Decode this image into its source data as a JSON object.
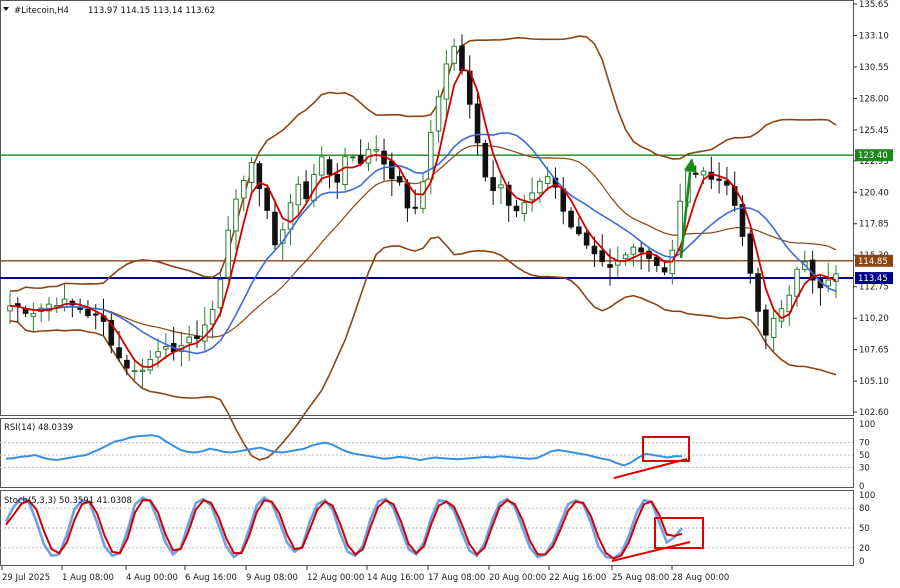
{
  "header": {
    "symbol": "#Litecoin,H4",
    "ohlc": "113.97 114.15 113.14 113.62"
  },
  "colors": {
    "up": "#2e7d32",
    "down": "#111111",
    "sma_fast": "#d00000",
    "sma_slow": "#3d6bd9",
    "bollinger": "#8b4513",
    "rsi": "#3a8fe0",
    "stoch_main": "#6fa0e8",
    "stoch_signal": "#d00000",
    "green_level": "#1a8a1a",
    "brown_level": "#8b4513",
    "blue_level": "#00008b",
    "annotation": "#e00000"
  },
  "chart_data": [
    {
      "type": "candlestick",
      "title": "#Litecoin,H4",
      "ylim": [
        102.6,
        135.65
      ],
      "y_ticks": [
        "135.65",
        "133.10",
        "130.55",
        "128.00",
        "125.45",
        "122.95",
        "120.40",
        "117.85",
        "115.30",
        "112.75",
        "110.20",
        "107.65",
        "105.10",
        "102.60"
      ],
      "x_ticks": [
        "29 Jul 2025",
        "1 Aug 08:00",
        "4 Aug 00:00",
        "6 Aug 16:00",
        "9 Aug 08:00",
        "12 Aug 00:00",
        "14 Aug 16:00",
        "17 Aug 08:00",
        "20 Aug 00:00",
        "22 Aug 16:00",
        "25 Aug 08:00",
        "28 Aug 00:00"
      ],
      "close_path": [
        [
          0,
          111.2
        ],
        [
          3,
          110.8
        ],
        [
          6,
          111.6
        ],
        [
          9,
          111.0
        ],
        [
          12,
          109.8
        ],
        [
          14,
          107.0
        ],
        [
          16,
          105.8
        ],
        [
          18,
          106.8
        ],
        [
          20,
          108.2
        ],
        [
          22,
          107.6
        ],
        [
          24,
          108.9
        ],
        [
          26,
          110.5
        ],
        [
          27,
          113.6
        ],
        [
          28,
          117.4
        ],
        [
          29,
          119.8
        ],
        [
          30,
          121.2
        ],
        [
          31,
          123.0
        ],
        [
          32,
          121.0
        ],
        [
          33,
          118.5
        ],
        [
          34,
          116.2
        ],
        [
          35,
          117.6
        ],
        [
          36,
          119.5
        ],
        [
          37,
          121.2
        ],
        [
          38,
          120.2
        ],
        [
          39,
          121.6
        ],
        [
          40,
          123.4
        ],
        [
          41,
          122.0
        ],
        [
          42,
          121.6
        ],
        [
          43,
          122.9
        ],
        [
          44,
          123.5
        ],
        [
          45,
          122.4
        ],
        [
          46,
          123.9
        ],
        [
          47,
          124.1
        ],
        [
          48,
          122.6
        ],
        [
          49,
          121.6
        ],
        [
          50,
          121.0
        ],
        [
          51,
          119.0
        ],
        [
          52,
          119.5
        ],
        [
          53,
          121.5
        ],
        [
          54,
          125.3
        ],
        [
          55,
          128.5
        ],
        [
          56,
          131.2
        ],
        [
          57,
          132.3
        ],
        [
          58,
          130.1
        ],
        [
          59,
          127.4
        ],
        [
          60,
          124.0
        ],
        [
          61,
          121.8
        ],
        [
          62,
          120.6
        ],
        [
          63,
          121.0
        ],
        [
          64,
          119.4
        ],
        [
          65,
          118.6
        ],
        [
          66,
          119.6
        ],
        [
          67,
          120.4
        ],
        [
          68,
          121.5
        ],
        [
          69,
          121.9
        ],
        [
          70,
          120.6
        ],
        [
          71,
          119.2
        ],
        [
          72,
          117.8
        ],
        [
          73,
          116.8
        ],
        [
          74,
          115.8
        ],
        [
          75,
          115.0
        ],
        [
          76,
          114.4
        ],
        [
          77,
          114.0
        ],
        [
          78,
          114.6
        ],
        [
          79,
          115.2
        ],
        [
          80,
          115.9
        ],
        [
          81,
          116.0
        ],
        [
          82,
          115.2
        ],
        [
          83,
          114.6
        ],
        [
          84,
          114.2
        ],
        [
          85,
          115.8
        ],
        [
          86,
          119.5
        ],
        [
          87,
          121.9
        ],
        [
          88,
          122.1
        ],
        [
          89,
          121.7
        ],
        [
          90,
          121.9
        ],
        [
          91,
          121.5
        ],
        [
          92,
          120.9
        ],
        [
          93,
          119.4
        ],
        [
          94,
          117.2
        ],
        [
          95,
          113.4
        ],
        [
          96,
          110.8
        ],
        [
          97,
          108.5
        ],
        [
          98,
          110.1
        ],
        [
          99,
          111.0
        ],
        [
          100,
          112.4
        ],
        [
          101,
          113.9
        ],
        [
          102,
          114.4
        ],
        [
          103,
          113.5
        ],
        [
          104,
          113.1
        ],
        [
          105,
          113.6
        ],
        [
          106,
          113.6
        ]
      ],
      "candle_count": 107,
      "overlays": [
        "SMA fast (red)",
        "SMA slow (blue)",
        "Bollinger Bands (brown)"
      ],
      "levels": [
        {
          "label": "123.40",
          "value": 123.4,
          "color": "#1a8a1a"
        },
        {
          "label": "114.85",
          "value": 114.85,
          "color": "#8b4513"
        },
        {
          "label": "113.45",
          "value": 113.45,
          "color": "#00008b"
        }
      ],
      "annotations": [
        "green upward arrow"
      ]
    },
    {
      "type": "line",
      "title": "RSI(14) 48.0339",
      "ylim": [
        0,
        100
      ],
      "y_ticks": [
        "100",
        "70",
        "50",
        "30",
        "0"
      ],
      "series": [
        {
          "name": "RSI(14)",
          "values": [
            44,
            45,
            47,
            48,
            50,
            46,
            43,
            42,
            44,
            46,
            48,
            50,
            55,
            60,
            66,
            72,
            74,
            78,
            80,
            81,
            82,
            80,
            72,
            65,
            58,
            55,
            54,
            56,
            60,
            58,
            55,
            54,
            56,
            58,
            60,
            62,
            58,
            55,
            54,
            56,
            58,
            60,
            65,
            68,
            70,
            66,
            60,
            55,
            52,
            50,
            48,
            46,
            44,
            45,
            47,
            46,
            44,
            42,
            44,
            46,
            45,
            44,
            43,
            44,
            45,
            46,
            47,
            46,
            48,
            47,
            46,
            45,
            44,
            45,
            50,
            56,
            58,
            56,
            54,
            52,
            50,
            47,
            44,
            42,
            37,
            33,
            38,
            46,
            52,
            50,
            48,
            46,
            48,
            48
          ]
        }
      ]
    },
    {
      "type": "line",
      "title": "Stoch(5,3,3) 50.3591 41.0308",
      "ylim": [
        0,
        100
      ],
      "y_ticks": [
        "100",
        "80",
        "50",
        "20",
        "0"
      ],
      "series": [
        {
          "name": "%K",
          "values": [
            60,
            82,
            95,
            90,
            60,
            25,
            8,
            10,
            40,
            78,
            92,
            88,
            58,
            22,
            8,
            12,
            46,
            86,
            96,
            90,
            62,
            28,
            10,
            20,
            56,
            88,
            94,
            84,
            54,
            22,
            6,
            14,
            48,
            84,
            96,
            88,
            60,
            28,
            14,
            22,
            60,
            86,
            92,
            78,
            42,
            14,
            8,
            24,
            64,
            90,
            94,
            80,
            48,
            18,
            10,
            28,
            66,
            92,
            90,
            76,
            44,
            16,
            8,
            26,
            62,
            88,
            94,
            82,
            50,
            20,
            6,
            10,
            28,
            58,
            86,
            92,
            86,
            58,
            22,
            6,
            4,
            12,
            38,
            72,
            92,
            90,
            58,
            28,
            36,
            50
          ]
        },
        {
          "name": "%D",
          "values": [
            55,
            70,
            86,
            92,
            78,
            45,
            18,
            12,
            28,
            62,
            86,
            90,
            72,
            38,
            14,
            12,
            34,
            74,
            92,
            92,
            74,
            40,
            16,
            18,
            44,
            78,
            92,
            88,
            66,
            34,
            12,
            12,
            38,
            74,
            92,
            90,
            72,
            40,
            18,
            20,
            48,
            78,
            90,
            84,
            56,
            24,
            10,
            18,
            52,
            82,
            92,
            86,
            60,
            26,
            12,
            22,
            56,
            84,
            90,
            82,
            56,
            26,
            10,
            20,
            52,
            82,
            92,
            86,
            62,
            30,
            10,
            10,
            22,
            48,
            76,
            90,
            88,
            68,
            36,
            12,
            4,
            8,
            28,
            60,
            86,
            90,
            70,
            40,
            38,
            41
          ]
        }
      ]
    }
  ]
}
